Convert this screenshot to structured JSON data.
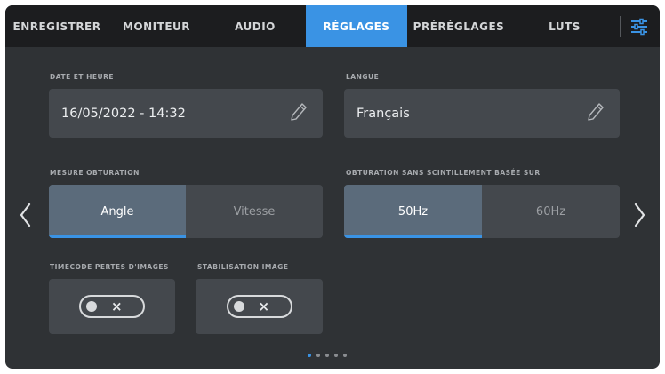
{
  "tabs": [
    {
      "label": "ENREGISTRER",
      "active": false
    },
    {
      "label": "MONITEUR",
      "active": false
    },
    {
      "label": "AUDIO",
      "active": false
    },
    {
      "label": "RÉGLAGES",
      "active": true
    },
    {
      "label": "PRÉRÉGLAGES",
      "active": false
    },
    {
      "label": "LUTS",
      "active": false
    }
  ],
  "icons": {
    "menu": "sliders-icon",
    "edit": "pencil-icon",
    "prev": "chevron-left-icon",
    "next": "chevron-right-icon"
  },
  "colors": {
    "accent": "#3a93e4",
    "tabbar": "#1c1d1f",
    "background": "#2f3235",
    "card": "#44484d",
    "selected": "#5b6b7b"
  },
  "main": {
    "date_time": {
      "label": "DATE ET HEURE",
      "value": "16/05/2022 - 14:32"
    },
    "language": {
      "label": "LANGUE",
      "value": "Français"
    },
    "segment_cards": [
      {
        "label": "MESURE OBTURATION",
        "options": [
          {
            "label": "Angle",
            "selected": true
          },
          {
            "label": "Vitesse",
            "selected": false
          }
        ]
      },
      {
        "label": "OBTURATION SANS SCINTILLEMENT BASÉE SUR",
        "options": [
          {
            "label": "50Hz",
            "selected": true
          },
          {
            "label": "60Hz",
            "selected": false
          }
        ]
      }
    ],
    "toggles": [
      {
        "label": "TIMECODE PERTES D'IMAGES",
        "state": "×",
        "enabled": false
      },
      {
        "label": "STABILISATION IMAGE",
        "state": "×",
        "enabled": false
      }
    ]
  },
  "pager": {
    "pages": 5,
    "current": 1
  }
}
